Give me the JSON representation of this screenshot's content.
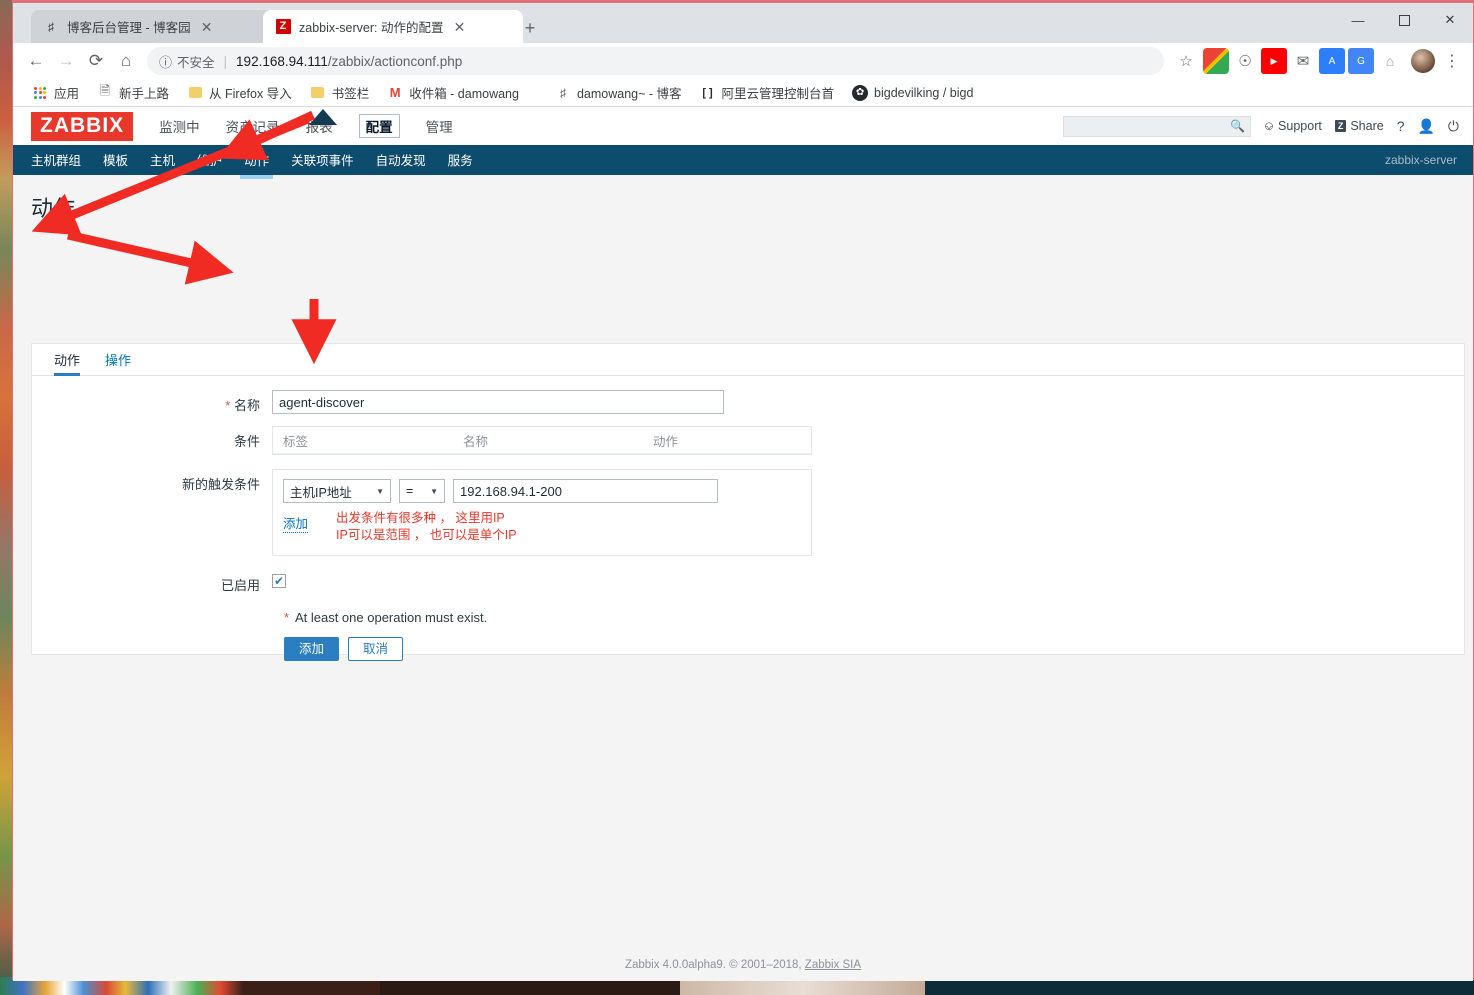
{
  "browser": {
    "tabs": [
      {
        "title": "博客后台管理 - 博客园",
        "favicon": "bookmark-script-icon",
        "active": false
      },
      {
        "title": "zabbix-server: 动作的配置",
        "favicon": "zabbix-favicon",
        "active": true
      }
    ],
    "new_tab_label": "+",
    "window_controls": {
      "minimize": "—",
      "maximize": "❐",
      "close": "✕"
    },
    "nav": {
      "back": "←",
      "forward": "→",
      "reload": "⟳",
      "home": "⌂"
    },
    "omnibox": {
      "info_icon": "ⓘ",
      "security_label": "不安全",
      "url_host": "192.168.94.111",
      "url_path": "/zabbix/actionconf.php"
    },
    "star_icon": "☆",
    "extensions": [
      "photos-ext",
      "podcast-ext",
      "youtube-ext",
      "gmail-ext",
      "docs-ext",
      "translate-ext",
      "home-ext"
    ],
    "menu_icon": "⋮",
    "bookmarks": [
      {
        "label": "应用",
        "icon": "apps-grid-icon"
      },
      {
        "label": "新手上路",
        "icon": "page-icon"
      },
      {
        "label": "从 Firefox 导入",
        "icon": "folder-icon"
      },
      {
        "label": "书签栏",
        "icon": "folder-icon"
      },
      {
        "label": "收件箱 - damowang",
        "icon": "gmail-icon"
      },
      {
        "label": "damowang~ - 博客",
        "icon": "bookmark-script-icon"
      },
      {
        "label": "阿里云管理控制台首",
        "icon": "aliyun-icon"
      },
      {
        "label": "bigdevilking / bigd",
        "icon": "github-icon"
      }
    ]
  },
  "zabbix": {
    "logo": "ZABBIX",
    "main_nav": [
      {
        "label": "监测中",
        "selected": false
      },
      {
        "label": "资产记录",
        "selected": false
      },
      {
        "label": "报表",
        "selected": false
      },
      {
        "label": "配置",
        "selected": true
      },
      {
        "label": "管理",
        "selected": false
      }
    ],
    "header_right": {
      "search_placeholder": "",
      "search_icon": "search-icon",
      "support": "Support",
      "share_badge": "Z",
      "share": "Share",
      "help": "?",
      "user_icon": "user-icon",
      "power_icon": "power-icon"
    },
    "sub_nav": [
      {
        "label": "主机群组",
        "active": false
      },
      {
        "label": "模板",
        "active": false
      },
      {
        "label": "主机",
        "active": false
      },
      {
        "label": "维护",
        "active": false
      },
      {
        "label": "动作",
        "active": true
      },
      {
        "label": "关联项事件",
        "active": false
      },
      {
        "label": "自动发现",
        "active": false
      },
      {
        "label": "服务",
        "active": false
      }
    ],
    "host_label": "zabbix-server",
    "page_title": "动作",
    "form_tabs": [
      {
        "label": "动作",
        "active": true
      },
      {
        "label": "操作",
        "active": false
      }
    ],
    "form": {
      "name_label": "名称",
      "name_required": "*",
      "name_value": "agent-discover",
      "conditions_label": "条件",
      "conditions_columns": [
        "标签",
        "名称",
        "动作"
      ],
      "new_condition_label": "新的触发条件",
      "condition_field": "主机IP地址",
      "condition_operator": "=",
      "condition_value": "192.168.94.1-200",
      "add_link": "添加",
      "annotation": "出发条件有很多种 ， 这里用IP\nIP可以是范围 ， 也可以是单个IP",
      "enabled_label": "已启用",
      "enabled_checked": "✔",
      "validation_required": "*",
      "validation_note": "At least one operation must exist.",
      "submit_button": "添加",
      "cancel_button": "取消"
    },
    "footer": {
      "text_before": "Zabbix 4.0.0alpha9. © 2001–2018, ",
      "link": "Zabbix SIA"
    }
  },
  "colors": {
    "brand_red": "#e8382c",
    "nav_blue": "#0d4c6d",
    "accent_blue": "#2b7ec1",
    "link_blue": "#0275b8",
    "annotation_red": "#e8382c"
  }
}
